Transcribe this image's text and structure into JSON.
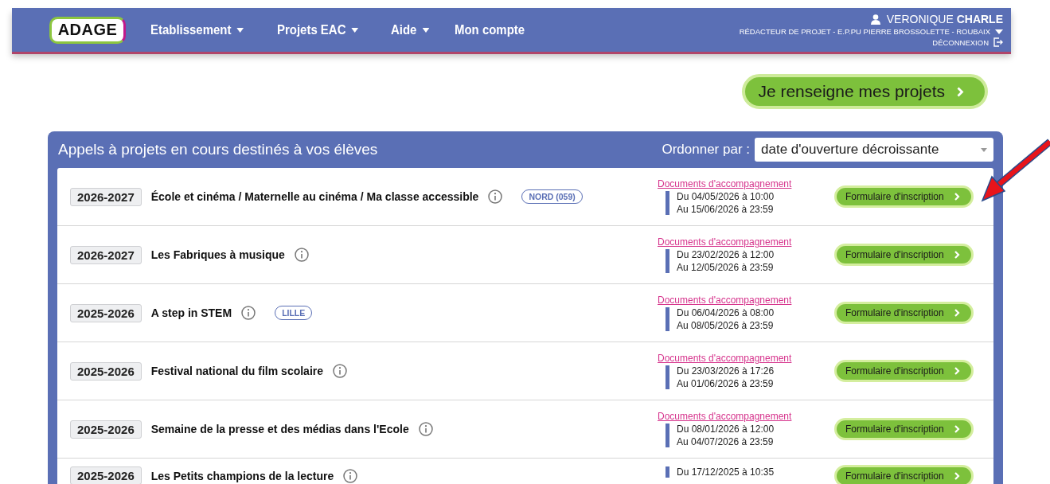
{
  "header": {
    "logo": "ADAGE",
    "nav": [
      {
        "label": "Etablissement",
        "dropdown": true
      },
      {
        "label": "Projets EAC",
        "dropdown": true
      },
      {
        "label": "Aide",
        "dropdown": true
      },
      {
        "label": "Mon compte",
        "dropdown": false
      }
    ],
    "user": {
      "name": "VERONIQUE **CHARLE**",
      "role": "RÉDACTEUR DE PROJET - E.P.PU PIERRE BROSSOLETTE - ROUBAIX",
      "logout": "DÉCONNEXION"
    }
  },
  "cta_button": "Je renseigne mes projets",
  "panel": {
    "title": "Appels à projets en cours destinés à vos élèves",
    "sort_label": "Ordonner par :",
    "sort_value": "date d'ouverture décroissante",
    "rows": [
      {
        "year": "2026-2027",
        "title": "École et cinéma / Maternelle au cinéma / Ma classe accessible",
        "tag": "NORD (059)",
        "documents": "Documents d'accompagnement",
        "start": "Du 04/05/2026 à 10:00",
        "end": "Au 15/06/2026 à 23:59",
        "button": "Formulaire d'inscription"
      },
      {
        "year": "2026-2027",
        "title": "Les Fabriques à musique",
        "documents": "Documents d'accompagnement",
        "start": "Du 23/02/2026 à 12:00",
        "end": "Au 12/05/2026 à 23:59",
        "button": "Formulaire d'inscription"
      },
      {
        "year": "2025-2026",
        "title": "A step in STEM",
        "tag": "LILLE",
        "documents": "Documents d'accompagnement",
        "start": "Du 06/04/2026 à 08:00",
        "end": "Au 08/05/2026 à 23:59",
        "button": "Formulaire d'inscription"
      },
      {
        "year": "2025-2026",
        "title": "Festival national du film scolaire",
        "documents": "Documents d'accompagnement",
        "start": "Du 23/03/2026 à 17:26",
        "end": "Au 01/06/2026 à 23:59",
        "button": "Formulaire d'inscription"
      },
      {
        "year": "2025-2026",
        "title": "Semaine de la presse et des médias dans l'Ecole",
        "documents": "Documents d'accompagnement",
        "start": "Du 08/01/2026 à 12:00",
        "end": "Au 04/07/2026 à 23:59",
        "button": "Formulaire d'inscription"
      },
      {
        "year": "2025-2026",
        "title": "Les Petits champions de la lecture",
        "start": "Du 17/12/2025 à 10:35",
        "button": "Formulaire d'inscription"
      }
    ]
  }
}
